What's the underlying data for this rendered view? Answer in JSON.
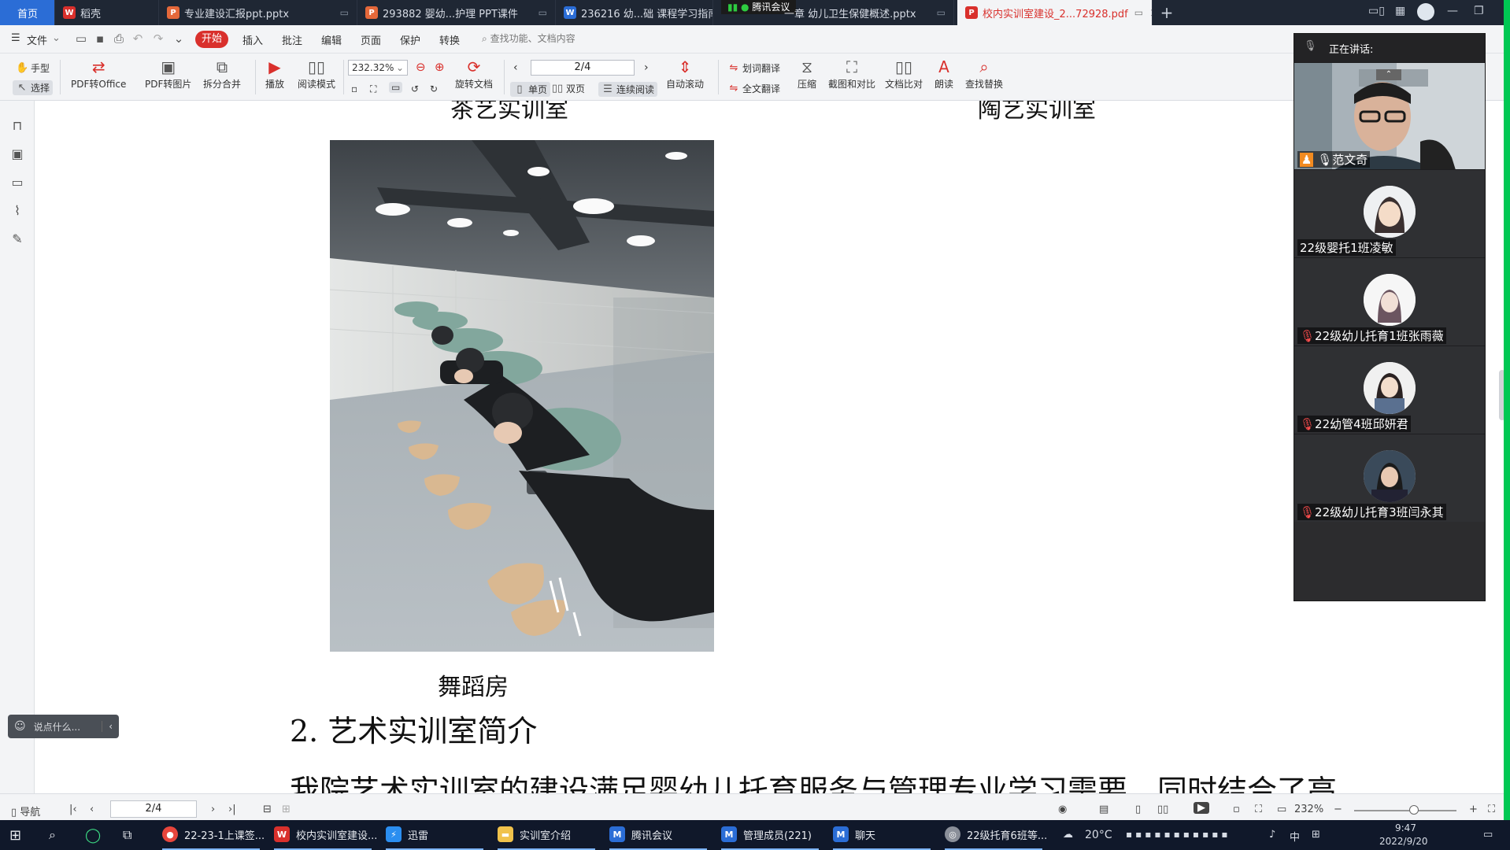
{
  "tabs": [
    {
      "label": "首页",
      "icon": "home"
    },
    {
      "label": "稻壳",
      "icon": "wps-logo-icon"
    },
    {
      "label": "专业建设汇报ppt.pptx",
      "icon": "ppt-icon"
    },
    {
      "label": "293882 婴幼...护理 PPT课件",
      "icon": "ppt-icon"
    },
    {
      "label": "236216 幼...础 课程学习指南",
      "icon": "word-icon"
    },
    {
      "label": "一章 幼儿卫生保健概述.pptx",
      "icon": "ppt-icon"
    },
    {
      "label": "校内实训室建设_2...72928.pdf",
      "icon": "pdf-icon"
    }
  ],
  "meeting_indicator": "腾讯会议",
  "menu": {
    "file": "文件",
    "start": "开始",
    "items": [
      "插入",
      "批注",
      "编辑",
      "页面",
      "保护",
      "转换"
    ],
    "search_placeholder": "查找功能、文档内容"
  },
  "ribbon": {
    "hand": "手型",
    "select": "选择",
    "pdf_to_office": "PDF转Office",
    "pdf_to_image": "PDF转图片",
    "split_merge": "拆分合并",
    "play": "播放",
    "read_mode": "阅读模式",
    "zoom": "232.32%",
    "rotate": "旋转文档",
    "page": "2/4",
    "single": "单页",
    "double": "双页",
    "continuous": "连续阅读",
    "auto_scroll": "自动滚动",
    "word_translate": "划词翻译",
    "full_translate": "全文翻译",
    "compress": "压缩",
    "screenshot_compare": "截图和对比",
    "doc_compare": "文档比对",
    "read_aloud": "朗读",
    "find_replace": "查找替换"
  },
  "document": {
    "caption_tea": "茶艺实训室",
    "caption_pottery": "陶艺实训室",
    "caption_dance": "舞蹈房",
    "heading": "2. 艺术实训室简介",
    "paragraph": "我院艺术实训室的建设满足婴幼儿托育服务与管理专业学习需要，同时结合了高"
  },
  "chat": {
    "placeholder": "说点什么..."
  },
  "bottom": {
    "nav": "导航",
    "page": "2/4",
    "zoom": "232%"
  },
  "meeting": {
    "speaking": "正在讲话:",
    "participants": [
      {
        "name": "范文奇",
        "has_video": true
      },
      {
        "name": "22级婴托1班凌敏",
        "has_video": false
      },
      {
        "name": "22级幼儿托育1班张雨薇",
        "has_video": false
      },
      {
        "name": "22幼管4班邱妍君",
        "has_video": false
      },
      {
        "name": "22级幼儿托育3班闫永其",
        "has_video": false
      }
    ]
  },
  "taskbar": {
    "apps": [
      {
        "label": "22-23-1上课签...",
        "icon": "chrome-icon"
      },
      {
        "label": "校内实训室建设...",
        "icon": "wps-icon"
      },
      {
        "label": "迅雷",
        "icon": "thunder-icon"
      },
      {
        "label": "实训室介绍",
        "icon": "folder-icon"
      },
      {
        "label": "腾讯会议",
        "icon": "tencent-meeting-icon"
      },
      {
        "label": "管理成员(221)",
        "icon": "tencent-meeting-icon"
      },
      {
        "label": "聊天",
        "icon": "tencent-meeting-icon"
      },
      {
        "label": "22级托育6班等...",
        "icon": "classroom-icon"
      }
    ],
    "weather": "20°C",
    "ime": "中",
    "time": "9:47",
    "date": "2022/9/20"
  },
  "colors": {
    "accent": "#d9302c",
    "tabbar": "#1f2734",
    "taskbar": "#10182a",
    "meeting_bg": "#2c2c2e",
    "green_strip": "#00c853"
  }
}
